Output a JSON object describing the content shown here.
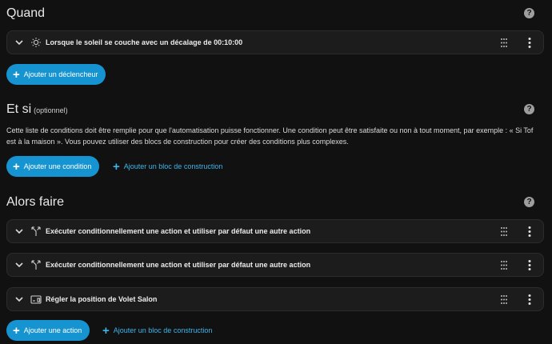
{
  "when": {
    "title": "Quand",
    "trigger_label": "Lorsque le soleil se couche avec un décalage de 00:10:00",
    "add_trigger": "Ajouter un déclencheur"
  },
  "and_if": {
    "title": "Et si",
    "optional": "(optionnel)",
    "description": "Cette liste de conditions doit être remplie pour que l'automatisation puisse fonctionner. Une condition peut être satisfaite ou non à tout moment, par exemple : « Si Tof est à la maison ». Vous pouvez utiliser des blocs de construction pour créer des conditions plus complexes.",
    "add_condition": "Ajouter une condition",
    "add_building_block": "Ajouter un bloc de construction"
  },
  "then_do": {
    "title": "Alors faire",
    "actions": [
      "Exécuter conditionnellement une action et utiliser par défaut une autre action",
      "Exécuter conditionnellement une action et utiliser par défaut une autre action",
      "Régler la position de Volet Salon"
    ],
    "add_action": "Ajouter une action",
    "add_building_block": "Ajouter un bloc de construction"
  },
  "help_glyph": "?",
  "plus_glyph": "+",
  "colors": {
    "background": "#111111",
    "card": "#1c1c1c",
    "primary": "#1694d1",
    "link": "#3fb5ec"
  }
}
